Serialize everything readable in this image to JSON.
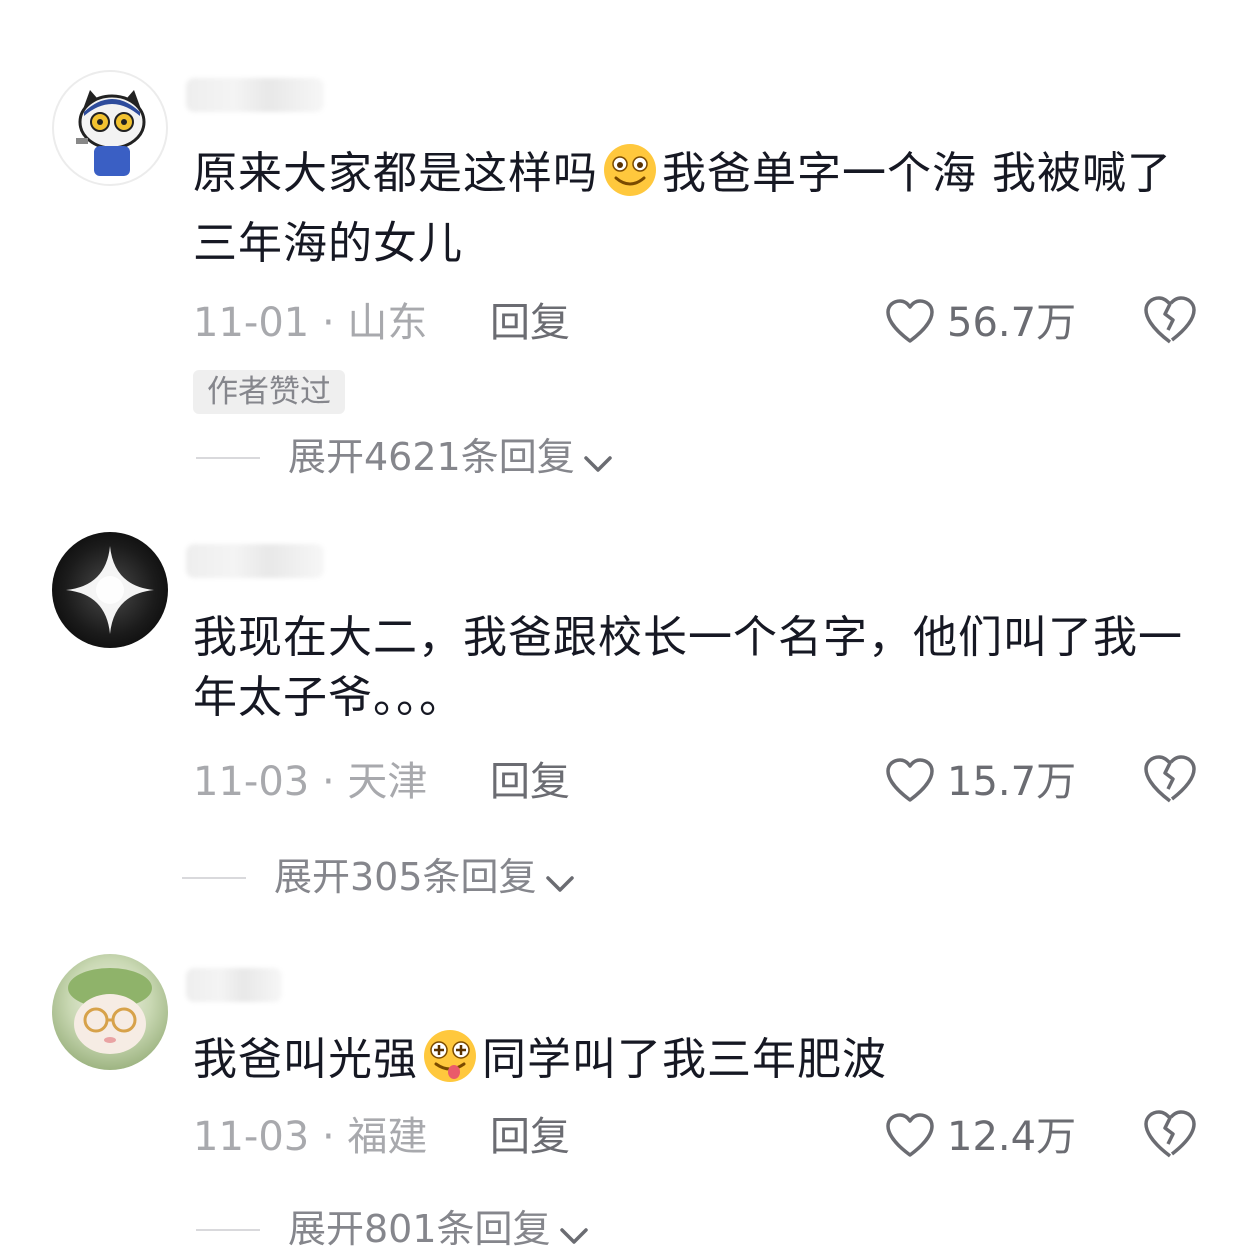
{
  "comments": [
    {
      "avatar": "cartoon-cat-avatar",
      "text_before": "原来大家都是这样吗",
      "emoji": "smile-emoji",
      "text_after": "我爸单字一个海 我被喊了三年海的女儿",
      "date": "11-01",
      "location": "山东",
      "reply_label": "回复",
      "likes": "56.7万",
      "badge": "作者赞过",
      "expand_label": "展开4621条回复"
    },
    {
      "avatar": "dark-sparkle-avatar",
      "text_before": "我现在大二，我爸跟校长一个名字，他们叫了我一年太子爷。。。",
      "date": "11-03",
      "location": "天津",
      "reply_label": "回复",
      "likes": "15.7万",
      "expand_label": "展开305条回复"
    },
    {
      "avatar": "green-character-avatar",
      "text_before": "我爸叫光强",
      "emoji": "silly-tongue-emoji",
      "text_after": "同学叫了我三年肥波",
      "date": "11-03",
      "location": "福建",
      "reply_label": "回复",
      "likes": "12.4万",
      "expand_label": "展开801条回复"
    }
  ],
  "separator": " · ",
  "colors": {
    "text": "#161823",
    "meta": "#a8a9ad",
    "action": "#6b6c72",
    "emoji": "#ffc83d"
  }
}
